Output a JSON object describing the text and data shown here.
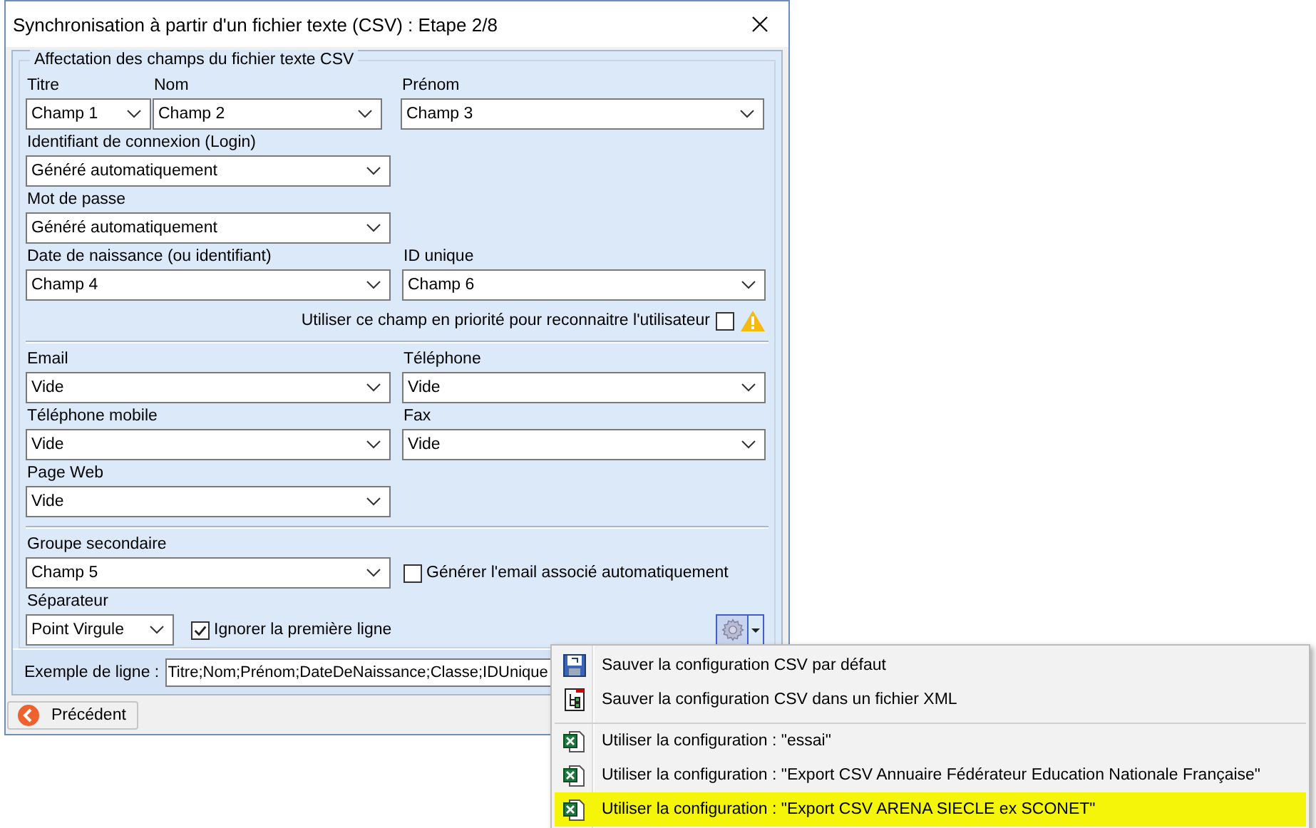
{
  "window": {
    "title": "Synchronisation à partir d'un fichier texte (CSV) : Etape 2/8"
  },
  "group": {
    "title": "Affectation des champs du fichier texte CSV"
  },
  "name_fields": [
    {
      "label": "Titre",
      "value": "Champ 1"
    },
    {
      "label": "Nom",
      "value": "Champ 2"
    },
    {
      "label": "Prénom",
      "value": "Champ 3"
    }
  ],
  "login": {
    "label": "Identifiant de connexion (Login)",
    "value": "Généré automatiquement"
  },
  "password": {
    "label": "Mot de passe",
    "value": "Généré automatiquement"
  },
  "birth": {
    "label": "Date de naissance (ou identifiant)",
    "value": "Champ 4"
  },
  "unique_id": {
    "label": "ID unique",
    "value": "Champ 6"
  },
  "priority": {
    "label": "Utiliser ce champ en priorité pour reconnaitre l'utilisateur",
    "checked": false
  },
  "contact_fields": [
    {
      "label": "Email",
      "value": "Vide"
    },
    {
      "label": "Téléphone",
      "value": "Vide"
    },
    {
      "label": "Téléphone mobile",
      "value": "Vide"
    },
    {
      "label": "Fax",
      "value": "Vide"
    },
    {
      "label": "Page Web",
      "value": "Vide"
    }
  ],
  "secondary_group": {
    "label": "Groupe secondaire",
    "value": "Champ 5"
  },
  "generate_email": {
    "label": "Générer l'email associé automatiquement",
    "checked": false
  },
  "separator": {
    "label": "Séparateur",
    "value": "Point Virgule"
  },
  "ignore_first": {
    "label": "Ignorer la première ligne",
    "checked": true
  },
  "example": {
    "label": "Exemple de ligne :",
    "value": "Titre;Nom;Prénom;DateDeNaissance;Classe;IDUnique"
  },
  "previous_button": "Précédent",
  "menu": [
    {
      "kind": "save",
      "label": "Sauver la configuration CSV par défaut",
      "divider_before": false,
      "selected": false
    },
    {
      "kind": "xml",
      "label": "Sauver la configuration CSV dans un fichier XML",
      "divider_before": false,
      "selected": false
    },
    {
      "kind": "config",
      "label": "Utiliser la configuration : \"essai\"",
      "divider_before": true,
      "selected": false
    },
    {
      "kind": "config",
      "label": "Utiliser la configuration : \"Export CSV Annuaire Fédérateur Education Nationale Française\"",
      "divider_before": false,
      "selected": false
    },
    {
      "kind": "config",
      "label": "Utiliser la configuration : \"Export CSV ARENA SIECLE ex SCONET\"",
      "divider_before": false,
      "selected": true
    }
  ]
}
